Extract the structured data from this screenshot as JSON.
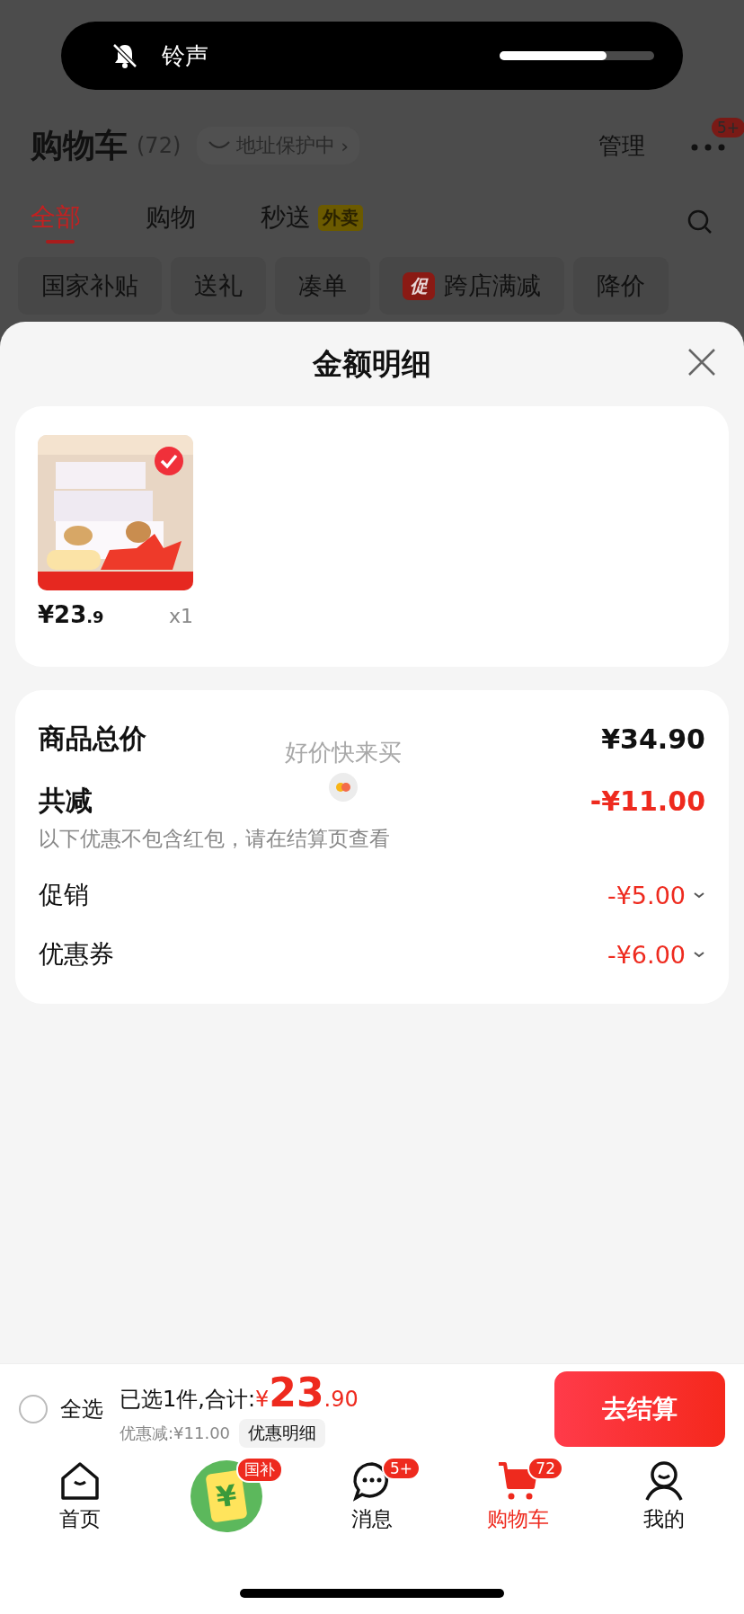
{
  "volume_hud": {
    "label": "铃声",
    "muted": true,
    "level": 0.69
  },
  "header": {
    "title": "购物车",
    "count": "(72)",
    "address_badge": "地址保护中",
    "address_arrow": "›",
    "manage": "管理",
    "more_badge": "5+"
  },
  "tabs": [
    {
      "label": "全部",
      "selected": true
    },
    {
      "label": "购物",
      "selected": false
    },
    {
      "label": "秒送",
      "tag": "外卖",
      "selected": false
    }
  ],
  "filter_chips": [
    {
      "label": "国家补贴"
    },
    {
      "label": "送礼"
    },
    {
      "label": "凑单"
    },
    {
      "label": "跨店满减",
      "tag": "促"
    },
    {
      "label": "降价"
    }
  ],
  "sheet": {
    "title": "金额明细",
    "items": [
      {
        "kind": "picture",
        "selected": true,
        "price_main": "¥23",
        "price_decimal": ".9",
        "quantity": "x1"
      }
    ],
    "summary": [
      {
        "kind": "total",
        "label": "商品总价",
        "value": "¥34.90"
      },
      {
        "kind": "discount_total",
        "label": "共减",
        "value": "-¥11.00",
        "note": "以下优惠不包含红包，请在结算页查看"
      },
      {
        "kind": "discount",
        "label": "促销",
        "value": "-¥5.00"
      },
      {
        "kind": "discount",
        "label": "优惠券",
        "value": "-¥6.00"
      }
    ],
    "loading_text": "好价快来买"
  },
  "checkout_bar": {
    "select_all_label": "全选",
    "select_all_checked": false,
    "selected_text": "已选1件,合计:",
    "total_symbol": "¥",
    "total_main": "23",
    "total_decimal": ".90",
    "discount": "优惠减:¥11.00",
    "detail_button": "优惠明细",
    "checkout_button": "去结算"
  },
  "bottom_nav": [
    {
      "kind": "home",
      "label": "首页",
      "selected": false
    },
    {
      "kind": "subsidy",
      "glyph": "¥",
      "badge": "国补",
      "selected": false
    },
    {
      "kind": "message",
      "label": "消息",
      "badge": "5+",
      "selected": false
    },
    {
      "kind": "cart",
      "label": "购物车",
      "badge": "72",
      "selected": true
    },
    {
      "kind": "profile",
      "label": "我的",
      "selected": false
    }
  ]
}
